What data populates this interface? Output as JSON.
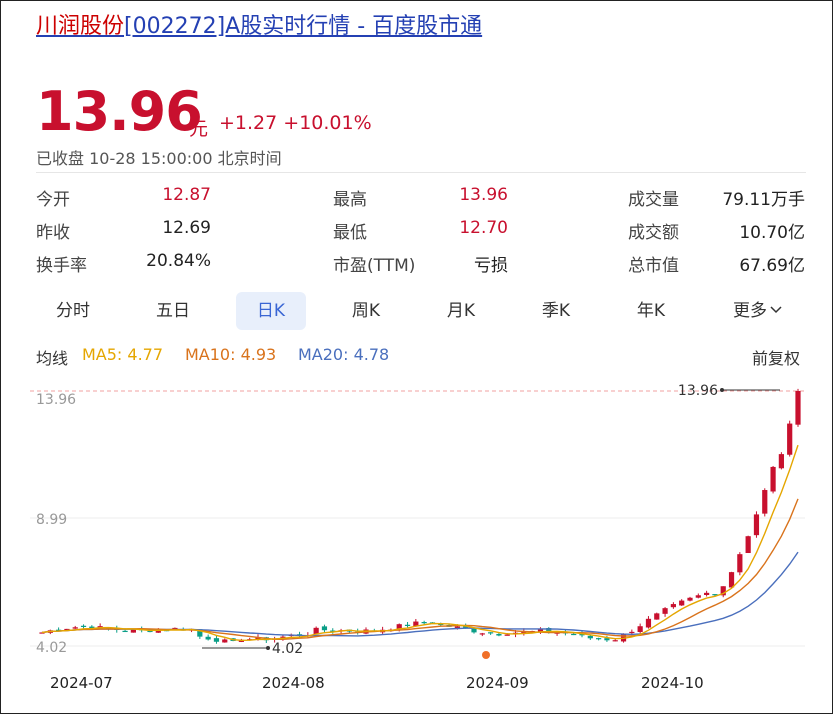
{
  "title": {
    "stock_name": "川润股份",
    "rest": "[002272]A股实时行情 - 百度股市通"
  },
  "quote": {
    "price": "13.96",
    "unit": "元",
    "change": "+1.27",
    "change_pct": "+10.01%",
    "status": "已收盘 10-28 15:00:00 北京时间"
  },
  "stats": {
    "open_label": "今开",
    "open": "12.87",
    "prev_close_label": "昨收",
    "prev_close": "12.69",
    "turnover_rate_label": "换手率",
    "turnover_rate": "20.84%",
    "high_label": "最高",
    "high": "13.96",
    "low_label": "最低",
    "low": "12.70",
    "pe_label": "市盈(TTM)",
    "pe": "亏损",
    "volume_label": "成交量",
    "volume": "79.11万手",
    "amount_label": "成交额",
    "amount": "10.70亿",
    "market_cap_label": "总市值",
    "market_cap": "67.69亿"
  },
  "tabs": [
    "分时",
    "五日",
    "日K",
    "周K",
    "月K",
    "季K",
    "年K",
    "更多"
  ],
  "active_tab": "日K",
  "ma_legend": {
    "label": "均线",
    "ma5": "MA5: 4.77",
    "ma10": "MA10: 4.93",
    "ma20": "MA20: 4.78",
    "adjust": "前复权"
  },
  "colors": {
    "up": "#c8102e",
    "down": "#0a9e87",
    "ma5": "#e5a600",
    "ma10": "#d9731c",
    "ma20": "#4a6fbd",
    "accent": "#3a66d4"
  },
  "chart_data": {
    "type": "candlestick",
    "y_ticks": [
      "13.96",
      "8.99",
      "4.02"
    ],
    "ylim": [
      4.02,
      13.96
    ],
    "x_ticks": [
      "2024-07",
      "2024-08",
      "2024-09",
      "2024-10"
    ],
    "max_label": "13.96",
    "min_label": "4.02",
    "last_closes": [
      6.0,
      6.35,
      6.9,
      7.6,
      8.3,
      9.15,
      10.1,
      11.0,
      11.5,
      12.69,
      13.96
    ]
  }
}
